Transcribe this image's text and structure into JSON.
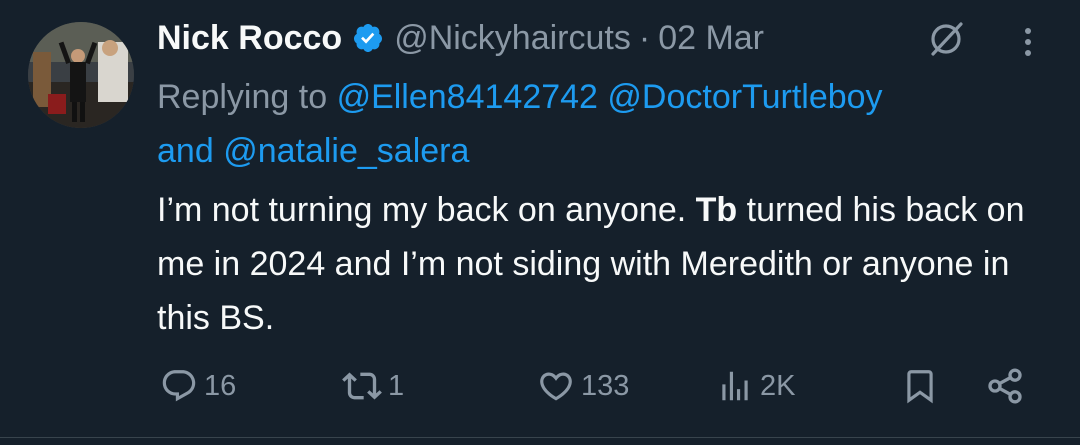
{
  "tweet": {
    "display_name": "Nick Rocco",
    "handle": "@Nickyhaircuts",
    "separator": "·",
    "date": "02 Mar",
    "replying_prefix": "Replying to",
    "mentions": [
      "@Ellen84142742",
      "@DoctorTurtleboy",
      "@natalie_salera"
    ],
    "mention_joiner": "and",
    "body_part1": "I’m not turning my back on anyone.",
    "body_bold": "Tb",
    "body_part2": "turned his back on me in 2024 and I’m not siding with Meredith or anyone in this BS."
  },
  "actions": {
    "replies": "16",
    "reposts": "1",
    "likes": "133",
    "views": "2K"
  },
  "icons": {
    "verified": "verified-badge-icon",
    "grok": "grok-icon",
    "more": "more-vertical-icon",
    "reply": "reply-icon",
    "repost": "repost-icon",
    "like": "heart-icon",
    "views": "views-icon",
    "bookmark": "bookmark-icon",
    "share": "share-icon"
  },
  "colors": {
    "background": "#15202b",
    "text": "#f7f9f9",
    "muted": "#8b98a5",
    "accent": "#1d9bf0"
  }
}
